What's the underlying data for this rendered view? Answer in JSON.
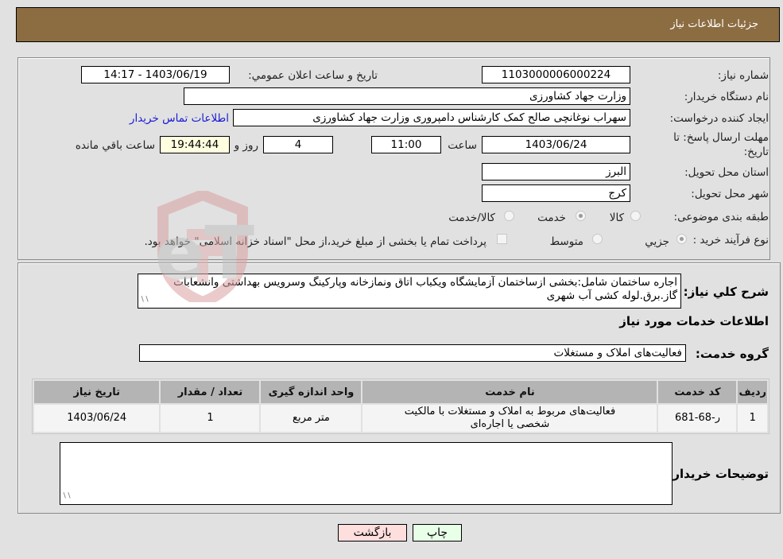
{
  "header": {
    "title": "جزئيات اطلاعات نياز"
  },
  "form": {
    "need_number": {
      "label": "شماره نياز:",
      "value": "1103000006000224"
    },
    "announce_datetime": {
      "label": "تاريخ و ساعت اعلان عمومي:",
      "value": "1403/06/19 - 14:17"
    },
    "buyer_org": {
      "label": "نام دستگاه خريدار:",
      "value": "وزارت جهاد کشاورزی"
    },
    "requester": {
      "label": "ايجاد کننده درخواست:",
      "value": "سهراب نوغانچی صالح کمک کارشناس دامپروری وزارت جهاد کشاورزی",
      "contact_link": "اطلاعات تماس خريدار"
    },
    "deadline": {
      "label_line1": "مهلت ارسال پاسخ: تا",
      "label_line2": "تاريخ:",
      "date": "1403/06/24",
      "time_label": "ساعت",
      "time": "11:00",
      "days": "4",
      "days_label": "روز و",
      "remaining": "19:44:44",
      "remaining_label": "ساعت باقي مانده"
    },
    "province": {
      "label": "استان محل تحويل:",
      "value": "البرز"
    },
    "city": {
      "label": "شهر محل تحويل:",
      "value": "کرج"
    },
    "category": {
      "label": "طبقه بندی موضوعی:",
      "options": [
        {
          "label": "کالا",
          "checked": false
        },
        {
          "label": "خدمت",
          "checked": true
        },
        {
          "label": "کالا/خدمت",
          "checked": false
        }
      ]
    },
    "purchase_type": {
      "label": "نوع فرآيند خريد :",
      "options": [
        {
          "label": "جزيي",
          "checked": true
        },
        {
          "label": "متوسط",
          "checked": false
        }
      ],
      "treasury_checkbox": {
        "label": "پرداخت تمام يا بخشی از مبلغ خريد،از محل \"اسناد خزانه اسلامی\" خواهد بود.",
        "checked": false
      }
    }
  },
  "description": {
    "label": "شرح کلي نياز:",
    "value": "اجاره ساختمان شامل:بخشی ازساختمان آزمايشگاه ويکباب اتاق ونمازخانه وپارکينگ وسرويس بهداشتی وانشعابات گاز.برق.لوله کشی آب شهری"
  },
  "services_section": {
    "title": "اطلاعات خدمات مورد نياز",
    "group_label": "گروه خدمت:",
    "group_value": "فعاليت‌های  املاک و مستغلات",
    "table": {
      "headers": [
        "رديف",
        "کد خدمت",
        "نام خدمت",
        "واحد اندازه گيری",
        "تعداد / مقدار",
        "تاريخ نياز"
      ],
      "rows": [
        [
          "1",
          "ر-68-681",
          "فعاليت‌های مربوط به املاک و مستغلات با مالکيت شخصی يا اجاره‌ای",
          "متر مربع",
          "1",
          "1403/06/24"
        ]
      ]
    }
  },
  "buyer_notes": {
    "label": "توضيحات خريدار:",
    "value": ""
  },
  "buttons": {
    "print": "چاپ",
    "back": "بازگشت"
  },
  "watermark": {
    "text": "AriaTender.neT"
  }
}
